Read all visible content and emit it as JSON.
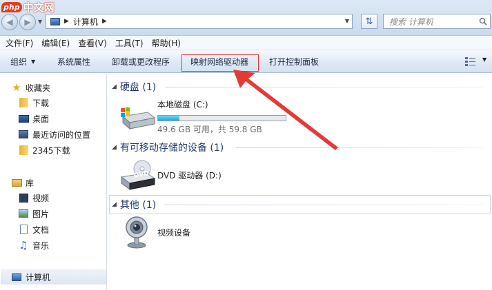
{
  "watermark": {
    "badge": "php",
    "text": "中文网"
  },
  "address": {
    "location": "计算机",
    "search_placeholder": "搜索 计算机"
  },
  "menu": [
    "文件(F)",
    "编辑(E)",
    "查看(V)",
    "工具(T)",
    "帮助(H)"
  ],
  "toolbar": {
    "organize": "组织",
    "system_properties": "系统属性",
    "uninstall": "卸载或更改程序",
    "map_drive": "映射网络驱动器",
    "control_panel": "打开控制面板"
  },
  "nav": {
    "favorites": "收藏夹",
    "downloads": "下载",
    "desktop": "桌面",
    "recent": "最近访问的位置",
    "dl2345": "2345下载",
    "libraries": "库",
    "videos": "视频",
    "pictures": "图片",
    "documents": "文档",
    "music": "音乐",
    "computer": "计算机"
  },
  "groups": {
    "hdd": {
      "title": "硬盘 (1)",
      "drive_name": "本地磁盘 (C:)",
      "drive_info": "49.6 GB 可用，共 59.8 GB",
      "used_fraction": 0.17
    },
    "removable": {
      "title": "有可移动存储的设备 (1)",
      "dvd_name": "DVD 驱动器 (D:)",
      "dvd_badge": "DVD"
    },
    "other": {
      "title": "其他 (1)",
      "camera_name": "视频设备"
    }
  },
  "colors": {
    "highlight": "#e53935",
    "group_title": "#1e3a6e"
  }
}
